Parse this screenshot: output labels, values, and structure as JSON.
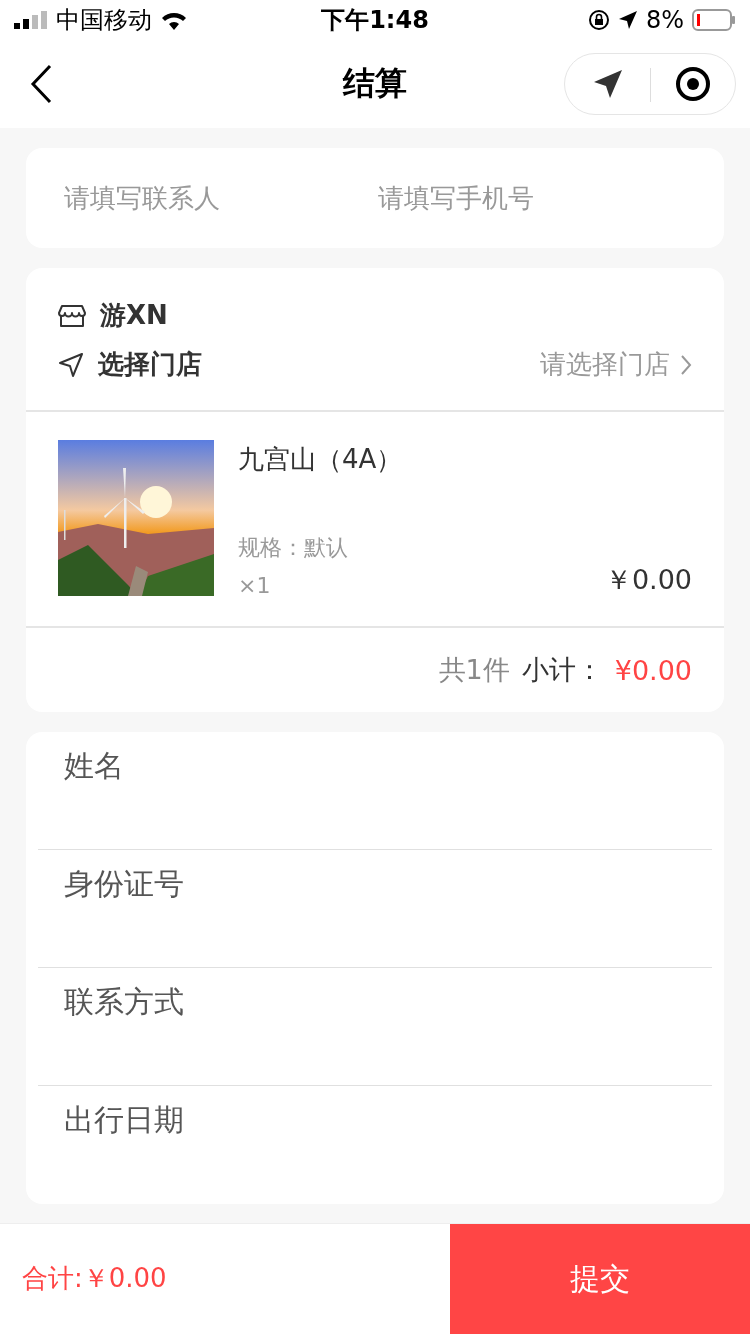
{
  "status_bar": {
    "carrier": "中国移动",
    "time": "下午1:48",
    "battery": "8%"
  },
  "nav": {
    "title": "结算"
  },
  "contact": {
    "name_placeholder": "请填写联系人",
    "phone_placeholder": "请填写手机号"
  },
  "order": {
    "shop": "游XN",
    "store_label": "选择门店",
    "store_value": "请选择门店",
    "product": {
      "kind": "picture",
      "name": "九宫山（4A）",
      "spec": "规格：默认",
      "quantity": "×1",
      "price": "￥0.00"
    },
    "count": "共1件",
    "subtotal_label": "小计：",
    "subtotal": "¥0.00"
  },
  "form": [
    {
      "label": "姓名"
    },
    {
      "label": "身份证号"
    },
    {
      "label": "联系方式"
    },
    {
      "label": "出行日期"
    }
  ],
  "footer": {
    "total": "合计:￥0.00",
    "submit": "提交"
  }
}
